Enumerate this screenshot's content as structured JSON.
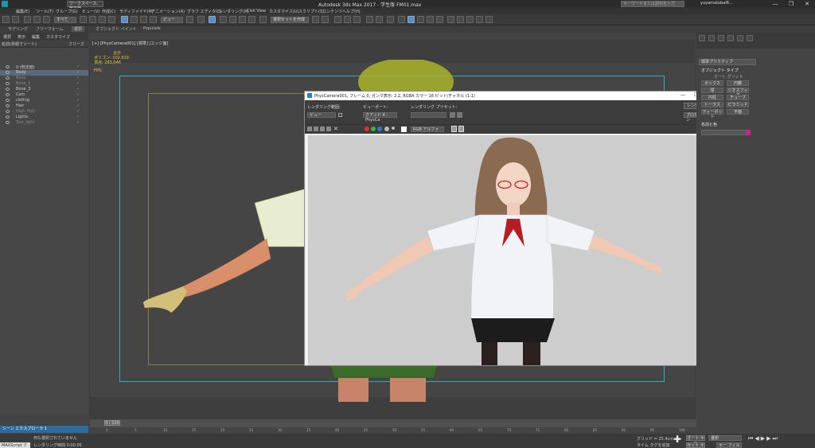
{
  "app": {
    "title": "Autodesk 3ds Max 2017   - 学生版   FM01.max",
    "workspace": "ワークスペース: 既定値",
    "search_placeholder": "キーワードまたは語句を入力",
    "user": "yuyamatobal6..."
  },
  "menu": [
    "編集(E)",
    "ツール(T)",
    "グループ(G)",
    "ビュー(V)",
    "作成(C)",
    "モディファイヤ(M)",
    "アニメーション(A)",
    "グラフ エディタ(D)",
    "レンダリング(R)",
    "Civil View",
    "カスタマイズ(U)",
    "スクリプト(S)",
    "コンテンツ",
    "ヘルプ(H)"
  ],
  "toolbar": {
    "filter": "すべて",
    "view": "ビュー",
    "selection_set": "選択セットを作成"
  },
  "ribbon": [
    "モデリング",
    "フリーフォーム",
    "選択",
    "オブジェクト ペイント",
    "Populate"
  ],
  "scene_explorer": {
    "tabs": [
      "選択",
      "表示",
      "編集",
      "カスタマイズ"
    ],
    "col_name": "名前(昇順でソート)",
    "col_freeze": "フリーズ",
    "items": [
      {
        "name": "0 (既定値)",
        "dim": false,
        "sel": false
      },
      {
        "name": "Body",
        "dim": false,
        "sel": true
      },
      {
        "name": "Bone",
        "dim": true,
        "sel": false
      },
      {
        "name": "Bone_1",
        "dim": true,
        "sel": false
      },
      {
        "name": "Bone_3",
        "dim": false,
        "sel": false
      },
      {
        "name": "Cam",
        "dim": false,
        "sel": false
      },
      {
        "name": "clothig",
        "dim": false,
        "sel": false
      },
      {
        "name": "Hair",
        "dim": false,
        "sel": false
      },
      {
        "name": "High_Poly",
        "dim": true,
        "sel": false
      },
      {
        "name": "Lights",
        "dim": false,
        "sel": false
      },
      {
        "name": "Test_light",
        "dim": true,
        "sel": false
      }
    ]
  },
  "viewport": {
    "label": "[+] [PhysCamera001] [標準] [エッジ面]",
    "stats_title": "合計",
    "polys_label": "ポリゴン:",
    "polys_value": "102,919",
    "verts_label": "頂点:",
    "verts_value": "283,046",
    "fps": "FPS:"
  },
  "render_window": {
    "title": "PhysCamera001, フレーム 0, ガンマ表示: 2.2, RGBA カラー 16 ビット/チャネル (1:1)",
    "area_label": "レンダリング範囲:",
    "area_value": "ビュー",
    "viewport_label": "ビューポート:",
    "viewport_value": "クアッド 4 - PhysCa",
    "preset_label": "レンダリング プリセット:",
    "render_button": "レンダリング",
    "mode_value": "プロダクション",
    "channel_value": "RGB アルファ",
    "minimize": "—",
    "maximize": "☐",
    "close": "✕"
  },
  "command_panel": {
    "category": "標準プリミティブ",
    "rollout": "オブジェクト タイプ",
    "autogrid": "オート グリッド",
    "buttons": [
      "ボックス",
      "円錐",
      "球",
      "ジオスフィア",
      "円柱",
      "チューブ",
      "トーラス",
      "ピラミッド",
      "ティーポット",
      "平面"
    ],
    "name_rollout": "名前と色"
  },
  "timeline": {
    "frame": "0 / 100",
    "ticks": [
      "0",
      "5",
      "10",
      "15",
      "20",
      "25",
      "30",
      "35",
      "40",
      "45",
      "50",
      "55",
      "60",
      "65",
      "70",
      "75",
      "80",
      "85",
      "90",
      "95",
      "100"
    ]
  },
  "status": {
    "explorer": "シーン エクスプローラ 1",
    "maxscript": "MAXScript ミニ",
    "no_selection": "何も選択されていません",
    "render_time": "レンダリング時間 0:00:05",
    "grid": "グリッド = 25.4cm",
    "add_time_tag": "タイム タグを追加",
    "auto_key": "オート キー",
    "set_key": "セット キー",
    "selection": "選択",
    "key_filter": "キー フィルタ..."
  }
}
